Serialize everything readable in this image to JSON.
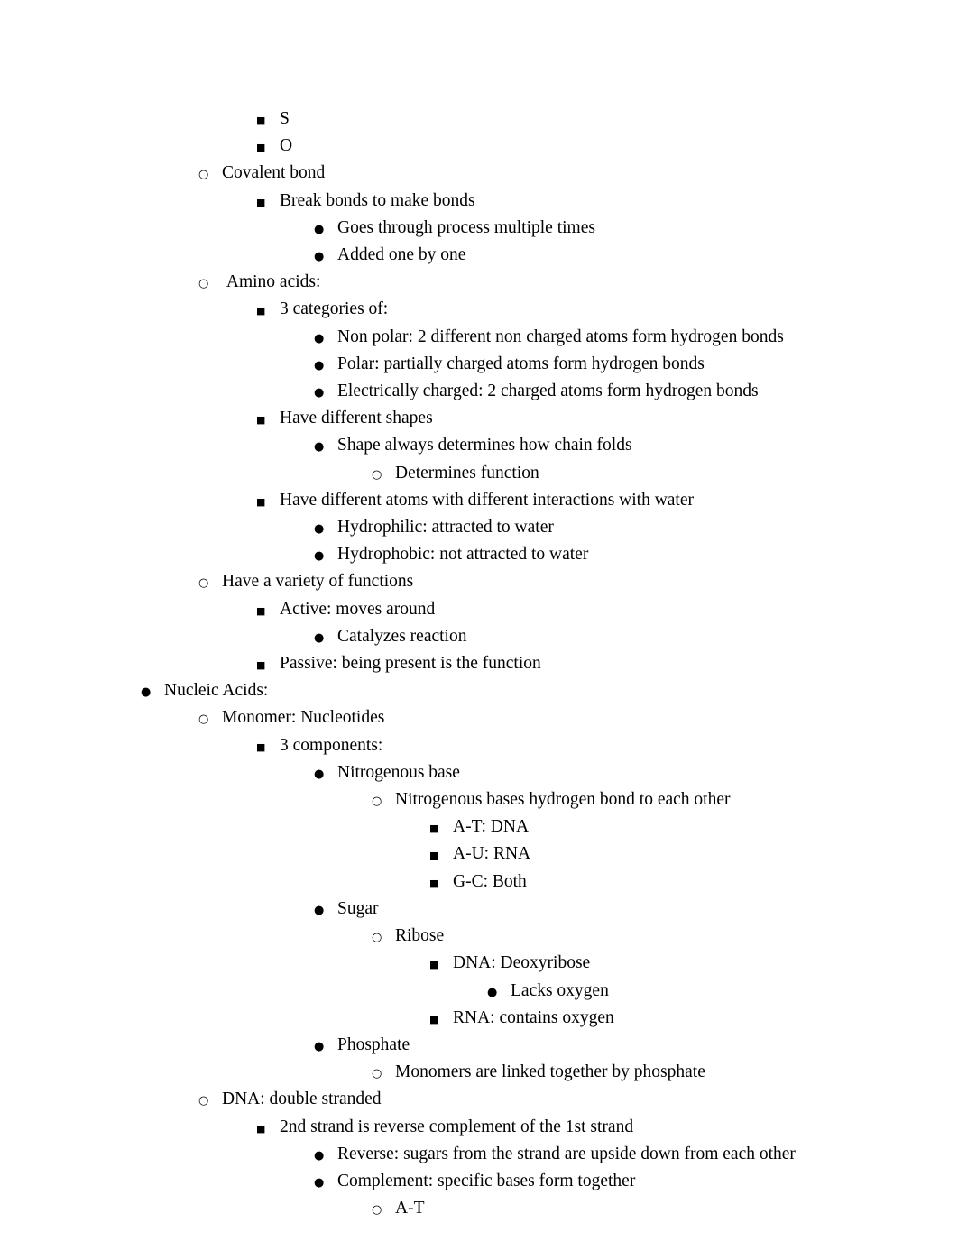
{
  "document": {
    "title": "Biology Notes Outline — Macromolecules",
    "bullets": {
      "disc": "●",
      "circle": "○",
      "square": "■"
    },
    "items": [
      {
        "level": 3,
        "bullet": "square",
        "text": "S"
      },
      {
        "level": 3,
        "bullet": "square",
        "text": "O"
      },
      {
        "level": 2,
        "bullet": "circle",
        "text": "Covalent bond"
      },
      {
        "level": 3,
        "bullet": "square",
        "text": "Break bonds to make bonds"
      },
      {
        "level": 4,
        "bullet": "disc",
        "text": "Goes through process multiple times"
      },
      {
        "level": 4,
        "bullet": "disc",
        "text": "Added one by one"
      },
      {
        "level": 2,
        "bullet": "circle",
        "text": " Amino acids:"
      },
      {
        "level": 3,
        "bullet": "square",
        "text": "3 categories of:"
      },
      {
        "level": 4,
        "bullet": "disc",
        "text": "Non polar: 2 different non charged atoms form hydrogen bonds"
      },
      {
        "level": 4,
        "bullet": "disc",
        "text": "Polar: partially charged atoms form hydrogen bonds"
      },
      {
        "level": 4,
        "bullet": "disc",
        "text": "Electrically charged: 2 charged atoms form hydrogen bonds"
      },
      {
        "level": 3,
        "bullet": "square",
        "text": "Have different shapes"
      },
      {
        "level": 4,
        "bullet": "disc",
        "text": "Shape always determines how chain folds"
      },
      {
        "level": 5,
        "bullet": "circle",
        "text": "Determines function"
      },
      {
        "level": 3,
        "bullet": "square",
        "text": "Have different atoms with different interactions with water"
      },
      {
        "level": 4,
        "bullet": "disc",
        "text": "Hydrophilic: attracted to water"
      },
      {
        "level": 4,
        "bullet": "disc",
        "text": "Hydrophobic: not attracted to water"
      },
      {
        "level": 2,
        "bullet": "circle",
        "text": "Have a variety of functions"
      },
      {
        "level": 3,
        "bullet": "square",
        "text": "Active: moves around"
      },
      {
        "level": 4,
        "bullet": "disc",
        "text": "Catalyzes reaction"
      },
      {
        "level": 3,
        "bullet": "square",
        "text": "Passive: being present is the function"
      },
      {
        "level": 1,
        "bullet": "disc",
        "text": "Nucleic Acids:"
      },
      {
        "level": 2,
        "bullet": "circle",
        "text": "Monomer: Nucleotides"
      },
      {
        "level": 3,
        "bullet": "square",
        "text": "3 components:"
      },
      {
        "level": 4,
        "bullet": "disc",
        "text": "Nitrogenous base"
      },
      {
        "level": 5,
        "bullet": "circle",
        "text": "Nitrogenous bases hydrogen bond to each other"
      },
      {
        "level": 6,
        "bullet": "square",
        "text": "A-T: DNA"
      },
      {
        "level": 6,
        "bullet": "square",
        "text": "A-U: RNA"
      },
      {
        "level": 6,
        "bullet": "square",
        "text": "G-C: Both"
      },
      {
        "level": 4,
        "bullet": "disc",
        "text": "Sugar"
      },
      {
        "level": 5,
        "bullet": "circle",
        "text": "Ribose"
      },
      {
        "level": 6,
        "bullet": "square",
        "text": "DNA: Deoxyribose"
      },
      {
        "level": 7,
        "bullet": "disc",
        "text": "Lacks oxygen"
      },
      {
        "level": 6,
        "bullet": "square",
        "text": "RNA: contains oxygen"
      },
      {
        "level": 4,
        "bullet": "disc",
        "text": "Phosphate"
      },
      {
        "level": 5,
        "bullet": "circle",
        "text": "Monomers are linked together by phosphate"
      },
      {
        "level": 2,
        "bullet": "circle",
        "text": "DNA: double stranded"
      },
      {
        "level": 3,
        "bullet": "square",
        "text": "2nd strand is reverse complement of the 1st strand"
      },
      {
        "level": 4,
        "bullet": "disc",
        "text": "Reverse: sugars from the strand are upside down from each other"
      },
      {
        "level": 4,
        "bullet": "disc",
        "text": "Complement: specific bases form together"
      },
      {
        "level": 5,
        "bullet": "circle",
        "text": "A-T"
      }
    ]
  }
}
